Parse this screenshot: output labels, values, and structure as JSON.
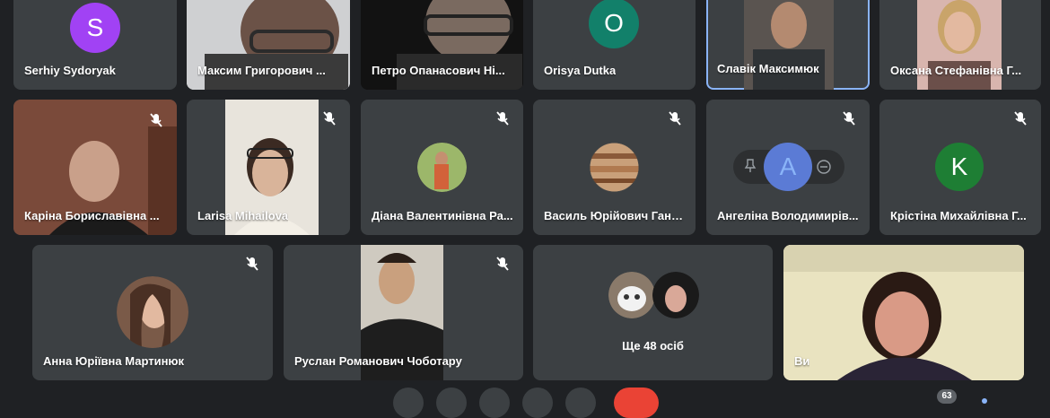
{
  "participants": {
    "p1": {
      "name": "Serhiy Sydoryak",
      "initial": "S",
      "color": "#a142f4"
    },
    "p2": {
      "name": "Максим Григорович ..."
    },
    "p3": {
      "name": "Петро Опанасович Ні..."
    },
    "p4": {
      "name": "Orisya Dutka",
      "initial": "O",
      "color": "#12806a"
    },
    "p5": {
      "name": "Славік Максимюк"
    },
    "p6": {
      "name": "Оксана Стефанівна Г..."
    },
    "p7": {
      "name": "Каріна Бориславівна ..."
    },
    "p8": {
      "name": "Larisa Mihailova"
    },
    "p9": {
      "name": "Діана Валентинівна Ра..."
    },
    "p10": {
      "name": "Василь Юрійович Ганд..."
    },
    "p11": {
      "name": "Ангеліна Володимирів...",
      "initial": "A"
    },
    "p12": {
      "name": "Крістіна Михайлівна Г...",
      "initial": "K",
      "color": "#1e7e34"
    },
    "p13": {
      "name": "Анна Юріївна Мартинюк"
    },
    "p14": {
      "name": "Руслан Романович Чоботару"
    },
    "more": {
      "label": "Ще 48 осіб"
    },
    "self": {
      "name": "Ви"
    }
  },
  "participant_count": "63",
  "colors": {
    "tile": "#3c4043",
    "background": "#1f2124",
    "active_border": "#8ab4f8",
    "end_call": "#ea4335"
  }
}
